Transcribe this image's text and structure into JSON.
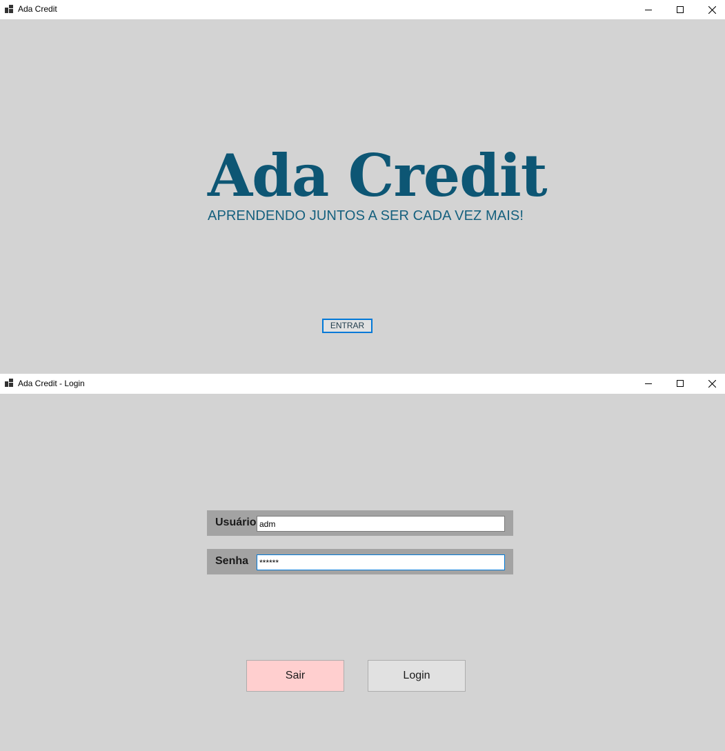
{
  "main_window": {
    "title": "Ada Credit",
    "brand": "Ada Credit",
    "tagline": "APRENDENDO JUNTOS A SER CADA VEZ MAIS!",
    "enter_button": "ENTRAR"
  },
  "login_window": {
    "title": "Ada Credit - Login",
    "username": {
      "label": "Usuário",
      "value": "adm"
    },
    "password": {
      "label": "Senha",
      "value": "******"
    },
    "exit_button": "Sair",
    "login_button": "Login"
  },
  "colors": {
    "background": "#d3d3d3",
    "brand": "#0d5674",
    "field_row": "#a3a3a3",
    "focus_border": "#0078d7",
    "exit_button_bg": "#ffcfcf",
    "button_bg": "#e1e1e1"
  },
  "icons": {
    "app": "app-icon",
    "minimize": "minimize-icon",
    "maximize": "maximize-icon",
    "close": "close-icon"
  }
}
